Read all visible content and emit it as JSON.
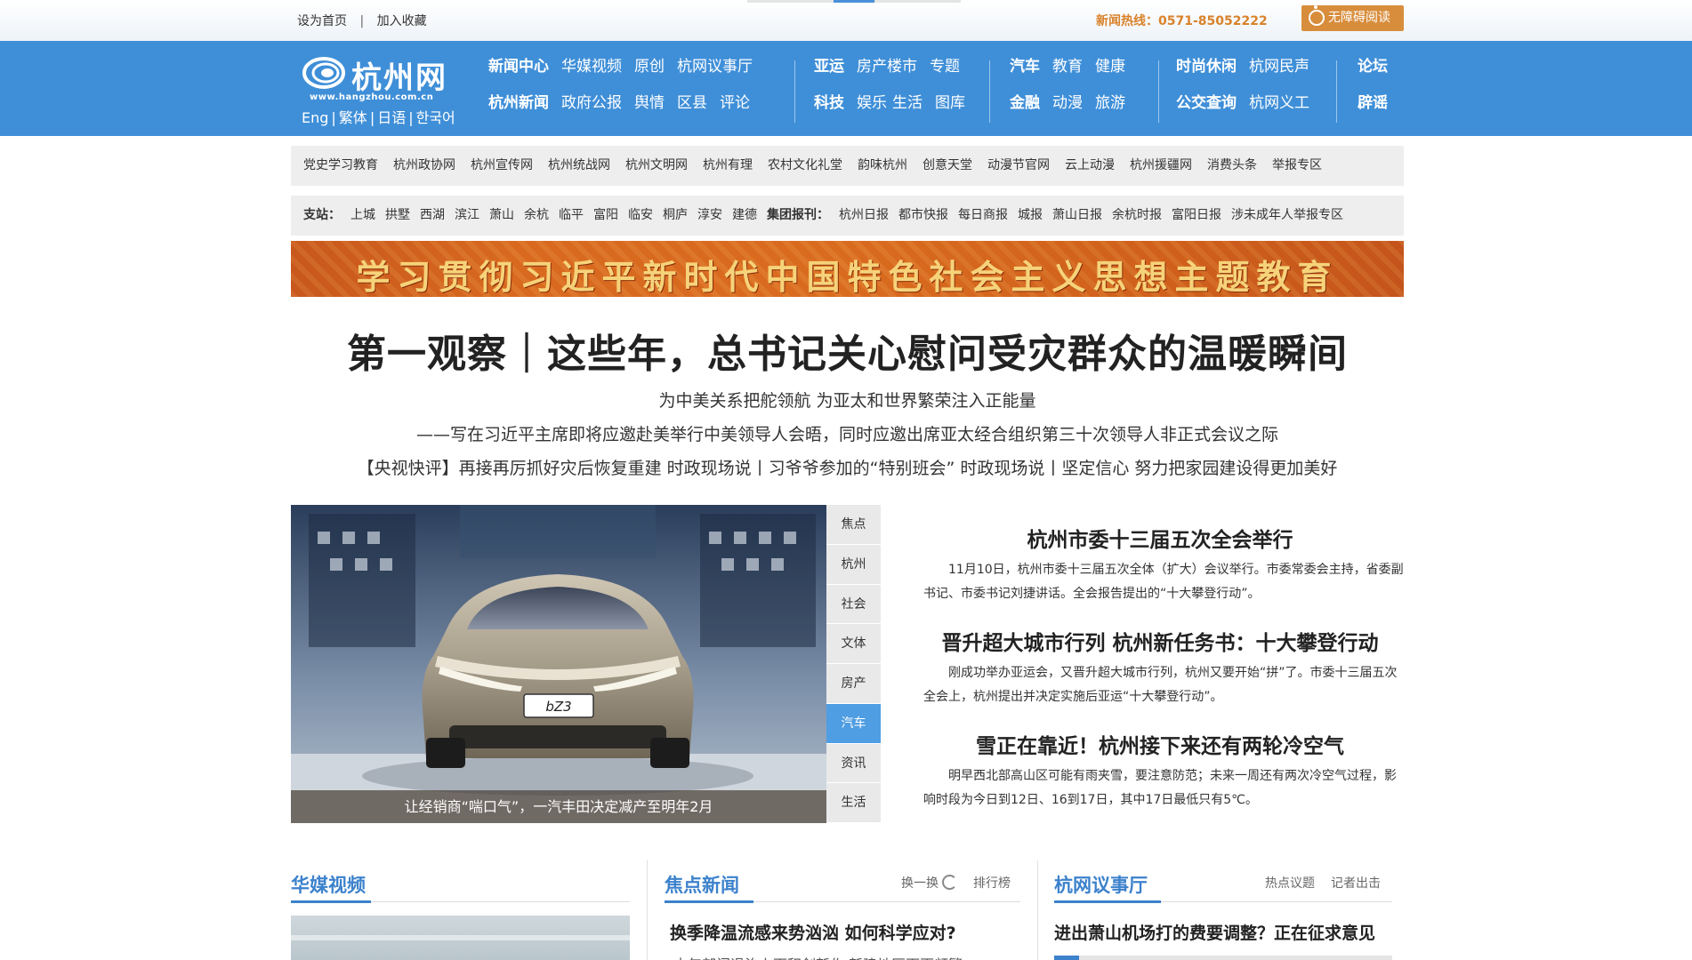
{
  "topbar": {
    "set_home": "设为首页",
    "separator": "|",
    "add_favorite": "加入收藏",
    "hotline": "新闻热线：0571-85052222",
    "accessibility": "无障碍阅读"
  },
  "logo": {
    "name": "杭州网",
    "url": "www.hangzhou.com.cn"
  },
  "langs": [
    "Eng",
    "繁体",
    "日语",
    "한국어"
  ],
  "nav": {
    "group1_row1": [
      "新闻中心",
      "华媒视频",
      "原创",
      "杭网议事厅"
    ],
    "group1_row2": [
      "杭州新闻",
      "政府公报",
      "舆情",
      "区县",
      "评论"
    ],
    "group2_row1": [
      "亚运",
      "房产楼市",
      "专题"
    ],
    "group2_row2": [
      "科技",
      "娱乐",
      "生活",
      "图库"
    ],
    "group3_row1": [
      "汽车",
      "教育",
      "健康"
    ],
    "group3_row2": [
      "金融",
      "动漫",
      "旅游"
    ],
    "group4_row1": [
      "时尚休闲",
      "杭网民声"
    ],
    "group4_row2": [
      "公交查询",
      "杭网义工"
    ],
    "group5_row1": [
      "论坛"
    ],
    "group5_row2": [
      "辟谣"
    ]
  },
  "linkbar1": [
    "党史学习教育",
    "杭州政协网",
    "杭州宣传网",
    "杭州统战网",
    "杭州文明网",
    "杭州有理",
    "农村文化礼堂",
    "韵味杭州",
    "创意天堂",
    "动漫节官网",
    "云上动漫",
    "杭州援疆网",
    "消费头条",
    "举报专区"
  ],
  "linkbar2": {
    "branch_label": "支站：",
    "branches": [
      "上城",
      "拱墅",
      "西湖",
      "滨江",
      "萧山",
      "余杭",
      "临平",
      "富阳",
      "临安",
      "桐庐",
      "淳安",
      "建德"
    ],
    "papers_label": "集团报刊：",
    "papers": [
      "杭州日报",
      "都市快报",
      "每日商报",
      "城报",
      "萧山日报",
      "余杭时报",
      "富阳日报",
      "涉未成年人举报专区"
    ]
  },
  "banner": {
    "text": "学习贯彻习近平新时代中国特色社会主义思想主题教育"
  },
  "headline": {
    "title": "第一观察｜这些年，总书记关心慰问受灾群众的温暖瞬间",
    "sub1": "为中美关系把舵领航 为亚太和世界繁荣注入正能量",
    "sub2": "——写在习近平主席即将应邀赴美举行中美领导人会晤，同时应邀出席亚太经合组织第三十次领导人非正式会议之际",
    "sub3": "【央视快评】再接再厉抓好灾后恢复重建 时政现场说丨习爷爷参加的“特别班会” 时政现场说丨坚定信心 努力把家园建设得更加美好"
  },
  "slider": {
    "caption": "让经销商“喘口气”，一汽丰田决定减产至明年2月",
    "plate_text": "bZ3",
    "tabs": [
      "焦点",
      "杭州",
      "社会",
      "文体",
      "房产",
      "汽车",
      "资讯",
      "生活"
    ],
    "active_tab": "汽车"
  },
  "news": [
    {
      "title": "杭州市委十三届五次全会举行",
      "desc": "11月10日，杭州市委十三届五次全体（扩大）会议举行。市委常委会主持，省委副书记、市委书记刘捷讲话。全会报告提出的“十大攀登行动”。"
    },
    {
      "title": "晋升超大城市行列 杭州新任务书：十大攀登行动",
      "desc": "刚成功举办亚运会，又晋升超大城市行列，杭州又要开始“拼”了。市委十三届五次全会上，杭州提出并决定实施后亚运“十大攀登行动”。"
    },
    {
      "title": "雪正在靠近！杭州接下来还有两轮冷空气",
      "desc": "明早西北部高山区可能有雨夹雪，要注意防范；未来一周还有两次冷空气过程，影响时段为今日到12日、16到17日，其中17日最低只有5℃。"
    }
  ],
  "bottom": {
    "col1": {
      "title": "华媒视频"
    },
    "col2": {
      "title": "焦点新闻",
      "switch": "换一换",
      "rank": "排行榜",
      "headline": "换季降温流感来势汹汹 如何科学应对?",
      "next": "十年部门退治上面积剑新作 新建地区面更频繁"
    },
    "col3": {
      "title": "杭网议事厅",
      "tab1": "热点议题",
      "tab2": "记者出击",
      "headline": "进出萧山机场打的费要调整？正在征求意见"
    }
  },
  "colors": {
    "nav_blue": "#3f8fd8",
    "accent_orange": "#d9822b",
    "link_blue": "#3c82cc"
  }
}
